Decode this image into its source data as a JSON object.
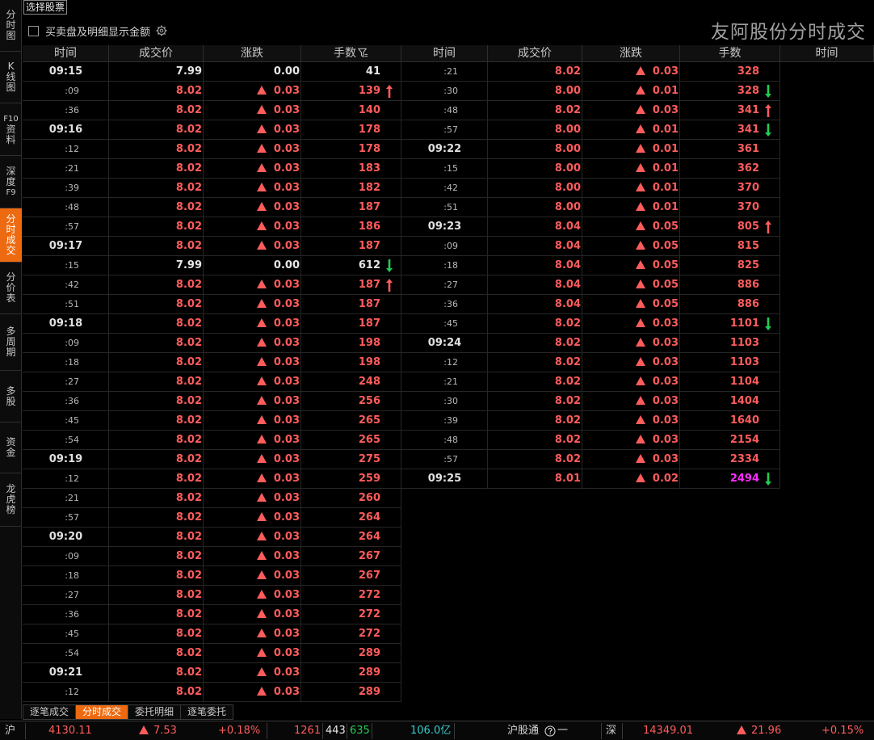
{
  "colors": {
    "up": "#ff5c5c",
    "down": "#22cc55",
    "accent": "#ee6a10",
    "highlight": "#ff2cff",
    "cyan": "#33cccc"
  },
  "nav": [
    {
      "lines": [
        "分",
        "时",
        "图"
      ]
    },
    {
      "lines": [
        "K",
        "线",
        "图"
      ]
    },
    {
      "lines": [
        "F10",
        "资",
        "料"
      ]
    },
    {
      "lines": [
        "深",
        "度",
        "F9"
      ]
    },
    {
      "lines": [
        "分",
        "时",
        "成",
        "交"
      ],
      "active": true
    },
    {
      "lines": [
        "分",
        "价",
        "表"
      ]
    },
    {
      "lines": [
        "多",
        "周",
        "期"
      ]
    },
    {
      "lines": [
        "多",
        "股"
      ]
    },
    {
      "lines": [
        "资",
        "金"
      ]
    },
    {
      "lines": [
        "龙",
        "虎",
        "榜"
      ]
    }
  ],
  "top": {
    "select_label": "选择股票",
    "option_label": "买卖盘及明细显示金额",
    "gear_icon": "gear-icon",
    "title": "友阿股份分时成交"
  },
  "headers": [
    "时间",
    "成交价",
    "涨跌",
    "手数",
    "时间",
    "成交价",
    "涨跌",
    "手数",
    "时间"
  ],
  "filter_icon": "filter-icon",
  "columns": [
    [
      {
        "time": "09:15",
        "main": true,
        "price": "7.99",
        "change": "0.00",
        "up": false,
        "vol": "41"
      },
      {
        "time": ":09",
        "price": "8.02",
        "change": "0.03",
        "up": true,
        "vol": "139",
        "arrow": "up"
      },
      {
        "time": ":36",
        "price": "8.02",
        "change": "0.03",
        "up": true,
        "vol": "140"
      },
      {
        "time": "09:16",
        "main": true,
        "price": "8.02",
        "change": "0.03",
        "up": true,
        "vol": "178"
      },
      {
        "time": ":12",
        "price": "8.02",
        "change": "0.03",
        "up": true,
        "vol": "178"
      },
      {
        "time": ":21",
        "price": "8.02",
        "change": "0.03",
        "up": true,
        "vol": "183"
      },
      {
        "time": ":39",
        "price": "8.02",
        "change": "0.03",
        "up": true,
        "vol": "182"
      },
      {
        "time": ":48",
        "price": "8.02",
        "change": "0.03",
        "up": true,
        "vol": "187"
      },
      {
        "time": ":57",
        "price": "8.02",
        "change": "0.03",
        "up": true,
        "vol": "186"
      },
      {
        "time": "09:17",
        "main": true,
        "price": "8.02",
        "change": "0.03",
        "up": true,
        "vol": "187"
      },
      {
        "time": ":15",
        "price": "7.99",
        "change": "0.00",
        "up": false,
        "vol": "612",
        "arrow": "down"
      },
      {
        "time": ":42",
        "price": "8.02",
        "change": "0.03",
        "up": true,
        "vol": "187",
        "arrow": "up"
      },
      {
        "time": ":51",
        "price": "8.02",
        "change": "0.03",
        "up": true,
        "vol": "187"
      },
      {
        "time": "09:18",
        "main": true,
        "price": "8.02",
        "change": "0.03",
        "up": true,
        "vol": "187"
      },
      {
        "time": ":09",
        "price": "8.02",
        "change": "0.03",
        "up": true,
        "vol": "198"
      },
      {
        "time": ":18",
        "price": "8.02",
        "change": "0.03",
        "up": true,
        "vol": "198"
      },
      {
        "time": ":27",
        "price": "8.02",
        "change": "0.03",
        "up": true,
        "vol": "248"
      },
      {
        "time": ":36",
        "price": "8.02",
        "change": "0.03",
        "up": true,
        "vol": "256"
      },
      {
        "time": ":45",
        "price": "8.02",
        "change": "0.03",
        "up": true,
        "vol": "265"
      },
      {
        "time": ":54",
        "price": "8.02",
        "change": "0.03",
        "up": true,
        "vol": "265"
      },
      {
        "time": "09:19",
        "main": true,
        "price": "8.02",
        "change": "0.03",
        "up": true,
        "vol": "275"
      },
      {
        "time": ":12",
        "price": "8.02",
        "change": "0.03",
        "up": true,
        "vol": "259"
      },
      {
        "time": ":21",
        "price": "8.02",
        "change": "0.03",
        "up": true,
        "vol": "260"
      },
      {
        "time": ":57",
        "price": "8.02",
        "change": "0.03",
        "up": true,
        "vol": "264"
      },
      {
        "time": "09:20",
        "main": true,
        "price": "8.02",
        "change": "0.03",
        "up": true,
        "vol": "264"
      },
      {
        "time": ":09",
        "price": "8.02",
        "change": "0.03",
        "up": true,
        "vol": "267"
      },
      {
        "time": ":18",
        "price": "8.02",
        "change": "0.03",
        "up": true,
        "vol": "267"
      },
      {
        "time": ":27",
        "price": "8.02",
        "change": "0.03",
        "up": true,
        "vol": "272"
      },
      {
        "time": ":36",
        "price": "8.02",
        "change": "0.03",
        "up": true,
        "vol": "272"
      },
      {
        "time": ":45",
        "price": "8.02",
        "change": "0.03",
        "up": true,
        "vol": "272"
      },
      {
        "time": ":54",
        "price": "8.02",
        "change": "0.03",
        "up": true,
        "vol": "289"
      },
      {
        "time": "09:21",
        "main": true,
        "price": "8.02",
        "change": "0.03",
        "up": true,
        "vol": "289"
      },
      {
        "time": ":12",
        "price": "8.02",
        "change": "0.03",
        "up": true,
        "vol": "289"
      }
    ],
    [
      {
        "time": ":21",
        "price": "8.02",
        "change": "0.03",
        "up": true,
        "vol": "328"
      },
      {
        "time": ":30",
        "price": "8.00",
        "change": "0.01",
        "up": true,
        "vol": "328",
        "arrow": "down"
      },
      {
        "time": ":48",
        "price": "8.02",
        "change": "0.03",
        "up": true,
        "vol": "341",
        "arrow": "up"
      },
      {
        "time": ":57",
        "price": "8.00",
        "change": "0.01",
        "up": true,
        "vol": "341",
        "arrow": "down"
      },
      {
        "time": "09:22",
        "main": true,
        "price": "8.00",
        "change": "0.01",
        "up": true,
        "vol": "361"
      },
      {
        "time": ":15",
        "price": "8.00",
        "change": "0.01",
        "up": true,
        "vol": "362"
      },
      {
        "time": ":42",
        "price": "8.00",
        "change": "0.01",
        "up": true,
        "vol": "370"
      },
      {
        "time": ":51",
        "price": "8.00",
        "change": "0.01",
        "up": true,
        "vol": "370"
      },
      {
        "time": "09:23",
        "main": true,
        "price": "8.04",
        "change": "0.05",
        "up": true,
        "vol": "805",
        "arrow": "up"
      },
      {
        "time": ":09",
        "price": "8.04",
        "change": "0.05",
        "up": true,
        "vol": "815"
      },
      {
        "time": ":18",
        "price": "8.04",
        "change": "0.05",
        "up": true,
        "vol": "825"
      },
      {
        "time": ":27",
        "price": "8.04",
        "change": "0.05",
        "up": true,
        "vol": "886"
      },
      {
        "time": ":36",
        "price": "8.04",
        "change": "0.05",
        "up": true,
        "vol": "886"
      },
      {
        "time": ":45",
        "price": "8.02",
        "change": "0.03",
        "up": true,
        "vol": "1101",
        "arrow": "down"
      },
      {
        "time": "09:24",
        "main": true,
        "price": "8.02",
        "change": "0.03",
        "up": true,
        "vol": "1103"
      },
      {
        "time": ":12",
        "price": "8.02",
        "change": "0.03",
        "up": true,
        "vol": "1103"
      },
      {
        "time": ":21",
        "price": "8.02",
        "change": "0.03",
        "up": true,
        "vol": "1104"
      },
      {
        "time": ":30",
        "price": "8.02",
        "change": "0.03",
        "up": true,
        "vol": "1404"
      },
      {
        "time": ":39",
        "price": "8.02",
        "change": "0.03",
        "up": true,
        "vol": "1640"
      },
      {
        "time": ":48",
        "price": "8.02",
        "change": "0.03",
        "up": true,
        "vol": "2154"
      },
      {
        "time": ":57",
        "price": "8.02",
        "change": "0.03",
        "up": true,
        "vol": "2334"
      },
      {
        "time": "09:25",
        "main": true,
        "price": "8.01",
        "change": "0.02",
        "up": true,
        "vol": "2494",
        "arrow": "down",
        "highlight": true
      }
    ]
  ],
  "tabs": [
    {
      "label": "逐笔成交"
    },
    {
      "label": "分时成交",
      "active": true
    },
    {
      "label": "委托明细"
    },
    {
      "label": "逐笔委托"
    }
  ],
  "status": {
    "sh_label": "沪",
    "sh_index": "4130.11",
    "sh_change": "7.53",
    "sh_pct": "+0.18%",
    "sh_up_count": "1261",
    "sh_flat_count": "443",
    "sh_down_count": "635",
    "amount": "106.0",
    "amount_unit": "亿",
    "hgt_label": "沪股通",
    "hgt_value": "一",
    "sz_label": "深",
    "sz_index": "14349.01",
    "sz_change": "21.96",
    "sz_pct": "+0.15%"
  }
}
